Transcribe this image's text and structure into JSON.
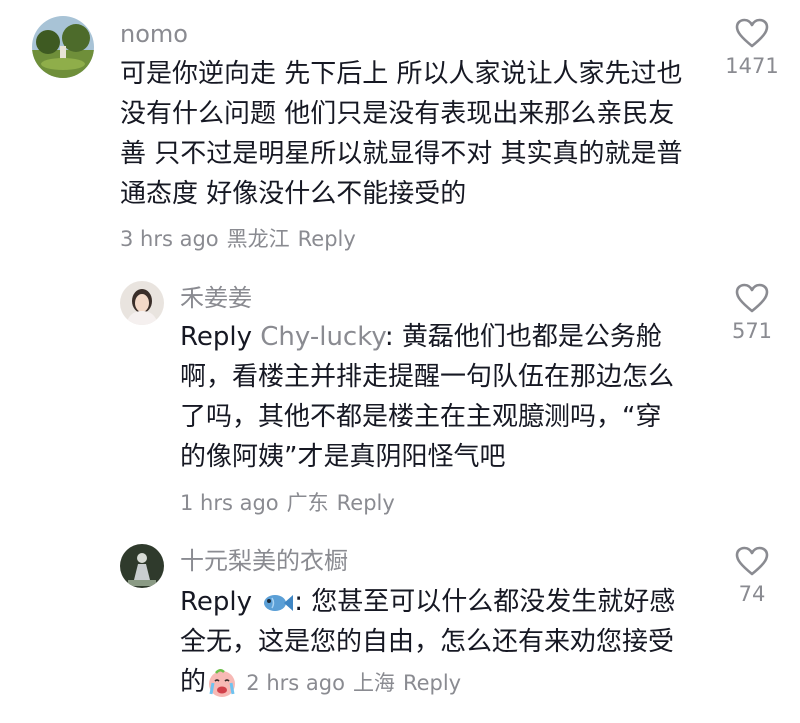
{
  "comments": [
    {
      "username": "nomo",
      "lines": [
        "可是你逆向走 先下后上 所以人家说让人家先过也",
        "没有什么问题 他们只是没有表现出来那么亲民友",
        "善 只不过是明星所以就显得不对 其实真的就是普",
        "通态度 好像没什么不能接受的"
      ],
      "time": "3 hrs ago",
      "location": "黑龙江",
      "reply_label": "Reply",
      "likes": "1471"
    },
    {
      "username": "禾姜姜",
      "reply_prefix": "Reply",
      "reply_target": "Chy-lucky",
      "lines": [
        ": 黄磊他们也都是公务舱",
        "啊，看楼主并排走提醒一句队伍在那边怎么",
        "了吗，其他不都是楼主在主观臆测吗，“穿",
        "的像阿姨”才是真阴阳怪气吧"
      ],
      "time": "1 hrs ago",
      "location": "广东",
      "reply_label": "Reply",
      "likes": "571"
    },
    {
      "username": "十元梨美的衣橱",
      "reply_prefix": "Reply",
      "reply_target_icon": "fish-emoji-icon",
      "lines": [
        ": 您甚至可以什么都没发生就好感",
        "全无，这是您的自由，怎么还有来劝您接受",
        "的"
      ],
      "trailing_emoji": "crying-face-emoji-icon",
      "time": "2 hrs ago",
      "location": "上海",
      "reply_label": "Reply",
      "likes": "74"
    }
  ],
  "colors": {
    "text": "#161823",
    "secondary": "#8a8b91"
  }
}
